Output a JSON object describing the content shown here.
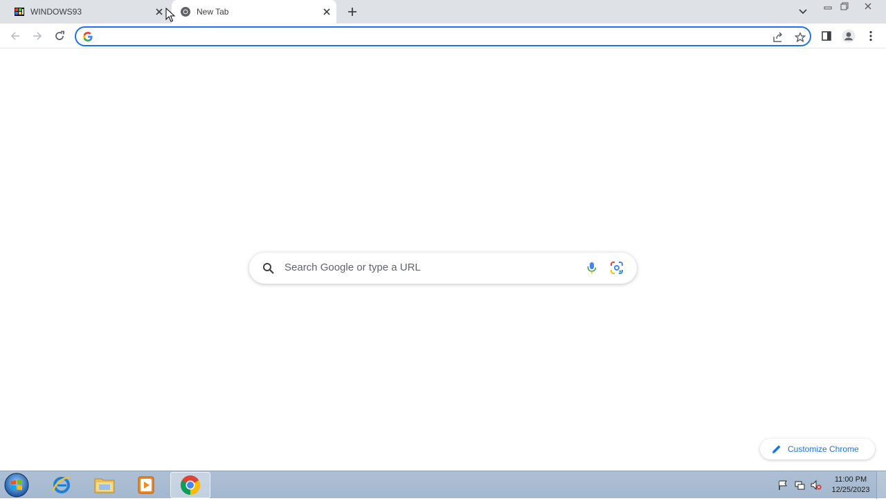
{
  "browser": {
    "tabs": [
      {
        "title": "WINDOWS93",
        "active": false,
        "icon": "windows93-favicon"
      },
      {
        "title": "New Tab",
        "active": true,
        "icon": "chrome-favicon"
      }
    ],
    "address_bar": {
      "value": "",
      "placeholder": ""
    }
  },
  "new_tab_page": {
    "search_placeholder": "Search Google or type a URL",
    "customize_label": "Customize Chrome"
  },
  "taskbar": {
    "apps": [
      "internet-explorer",
      "file-explorer",
      "media-player",
      "chrome"
    ],
    "time": "11:00 PM",
    "date": "12/25/2023"
  },
  "colors": {
    "accent": "#1a73e8",
    "tabstrip": "#dee1e6",
    "taskbar": "#a9bcd1"
  }
}
